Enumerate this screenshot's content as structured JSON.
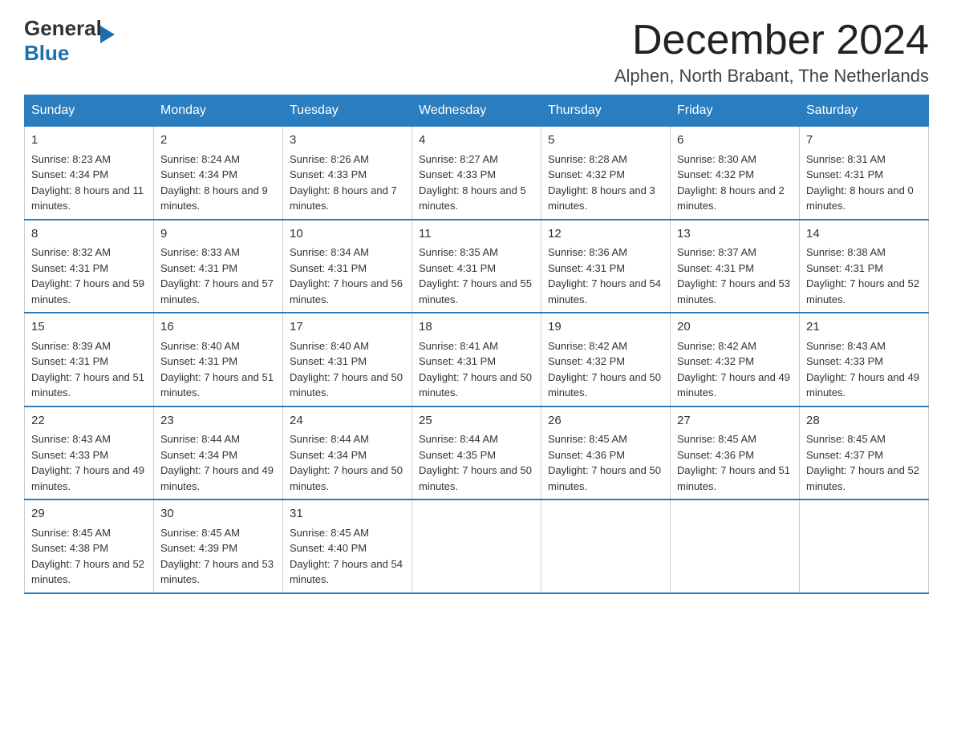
{
  "logo": {
    "general": "General",
    "blue": "Blue",
    "arrow_color": "#1a6faf"
  },
  "header": {
    "title": "December 2024",
    "location": "Alphen, North Brabant, The Netherlands"
  },
  "weekdays": [
    "Sunday",
    "Monday",
    "Tuesday",
    "Wednesday",
    "Thursday",
    "Friday",
    "Saturday"
  ],
  "weeks": [
    [
      {
        "day": "1",
        "sunrise": "8:23 AM",
        "sunset": "4:34 PM",
        "daylight": "8 hours and 11 minutes."
      },
      {
        "day": "2",
        "sunrise": "8:24 AM",
        "sunset": "4:34 PM",
        "daylight": "8 hours and 9 minutes."
      },
      {
        "day": "3",
        "sunrise": "8:26 AM",
        "sunset": "4:33 PM",
        "daylight": "8 hours and 7 minutes."
      },
      {
        "day": "4",
        "sunrise": "8:27 AM",
        "sunset": "4:33 PM",
        "daylight": "8 hours and 5 minutes."
      },
      {
        "day": "5",
        "sunrise": "8:28 AM",
        "sunset": "4:32 PM",
        "daylight": "8 hours and 3 minutes."
      },
      {
        "day": "6",
        "sunrise": "8:30 AM",
        "sunset": "4:32 PM",
        "daylight": "8 hours and 2 minutes."
      },
      {
        "day": "7",
        "sunrise": "8:31 AM",
        "sunset": "4:31 PM",
        "daylight": "8 hours and 0 minutes."
      }
    ],
    [
      {
        "day": "8",
        "sunrise": "8:32 AM",
        "sunset": "4:31 PM",
        "daylight": "7 hours and 59 minutes."
      },
      {
        "day": "9",
        "sunrise": "8:33 AM",
        "sunset": "4:31 PM",
        "daylight": "7 hours and 57 minutes."
      },
      {
        "day": "10",
        "sunrise": "8:34 AM",
        "sunset": "4:31 PM",
        "daylight": "7 hours and 56 minutes."
      },
      {
        "day": "11",
        "sunrise": "8:35 AM",
        "sunset": "4:31 PM",
        "daylight": "7 hours and 55 minutes."
      },
      {
        "day": "12",
        "sunrise": "8:36 AM",
        "sunset": "4:31 PM",
        "daylight": "7 hours and 54 minutes."
      },
      {
        "day": "13",
        "sunrise": "8:37 AM",
        "sunset": "4:31 PM",
        "daylight": "7 hours and 53 minutes."
      },
      {
        "day": "14",
        "sunrise": "8:38 AM",
        "sunset": "4:31 PM",
        "daylight": "7 hours and 52 minutes."
      }
    ],
    [
      {
        "day": "15",
        "sunrise": "8:39 AM",
        "sunset": "4:31 PM",
        "daylight": "7 hours and 51 minutes."
      },
      {
        "day": "16",
        "sunrise": "8:40 AM",
        "sunset": "4:31 PM",
        "daylight": "7 hours and 51 minutes."
      },
      {
        "day": "17",
        "sunrise": "8:40 AM",
        "sunset": "4:31 PM",
        "daylight": "7 hours and 50 minutes."
      },
      {
        "day": "18",
        "sunrise": "8:41 AM",
        "sunset": "4:31 PM",
        "daylight": "7 hours and 50 minutes."
      },
      {
        "day": "19",
        "sunrise": "8:42 AM",
        "sunset": "4:32 PM",
        "daylight": "7 hours and 50 minutes."
      },
      {
        "day": "20",
        "sunrise": "8:42 AM",
        "sunset": "4:32 PM",
        "daylight": "7 hours and 49 minutes."
      },
      {
        "day": "21",
        "sunrise": "8:43 AM",
        "sunset": "4:33 PM",
        "daylight": "7 hours and 49 minutes."
      }
    ],
    [
      {
        "day": "22",
        "sunrise": "8:43 AM",
        "sunset": "4:33 PM",
        "daylight": "7 hours and 49 minutes."
      },
      {
        "day": "23",
        "sunrise": "8:44 AM",
        "sunset": "4:34 PM",
        "daylight": "7 hours and 49 minutes."
      },
      {
        "day": "24",
        "sunrise": "8:44 AM",
        "sunset": "4:34 PM",
        "daylight": "7 hours and 50 minutes."
      },
      {
        "day": "25",
        "sunrise": "8:44 AM",
        "sunset": "4:35 PM",
        "daylight": "7 hours and 50 minutes."
      },
      {
        "day": "26",
        "sunrise": "8:45 AM",
        "sunset": "4:36 PM",
        "daylight": "7 hours and 50 minutes."
      },
      {
        "day": "27",
        "sunrise": "8:45 AM",
        "sunset": "4:36 PM",
        "daylight": "7 hours and 51 minutes."
      },
      {
        "day": "28",
        "sunrise": "8:45 AM",
        "sunset": "4:37 PM",
        "daylight": "7 hours and 52 minutes."
      }
    ],
    [
      {
        "day": "29",
        "sunrise": "8:45 AM",
        "sunset": "4:38 PM",
        "daylight": "7 hours and 52 minutes."
      },
      {
        "day": "30",
        "sunrise": "8:45 AM",
        "sunset": "4:39 PM",
        "daylight": "7 hours and 53 minutes."
      },
      {
        "day": "31",
        "sunrise": "8:45 AM",
        "sunset": "4:40 PM",
        "daylight": "7 hours and 54 minutes."
      },
      null,
      null,
      null,
      null
    ]
  ],
  "labels": {
    "sunrise": "Sunrise:",
    "sunset": "Sunset:",
    "daylight": "Daylight:"
  }
}
